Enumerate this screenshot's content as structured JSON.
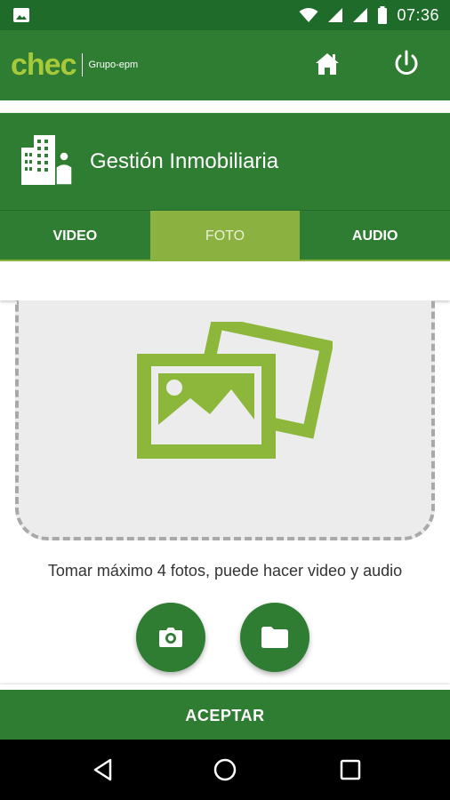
{
  "status_bar": {
    "time": "07:36",
    "icons": [
      "image-notification-icon",
      "wifi-icon",
      "signal-icon",
      "signal-icon",
      "battery-icon"
    ]
  },
  "app_bar": {
    "logo_text": "chec",
    "logo_group": "Grupo-epm",
    "home_icon": "home-icon",
    "power_icon": "power-icon"
  },
  "header": {
    "title": "Gestión Inmobiliaria",
    "icon": "building-person-icon"
  },
  "tabs": [
    {
      "label": "VIDEO",
      "active": false
    },
    {
      "label": "FOTO",
      "active": true
    },
    {
      "label": "AUDIO",
      "active": false
    }
  ],
  "media": {
    "placeholder_icon": "photos-icon",
    "hint": "Tomar máximo 4 fotos, puede hacer video y audio"
  },
  "actions": {
    "camera_icon": "camera-icon",
    "folder_icon": "folder-icon",
    "accept_label": "ACEPTAR"
  },
  "nav": {
    "back_icon": "back-icon",
    "home_icon": "home-circle-icon",
    "recent_icon": "recent-apps-icon"
  },
  "colors": {
    "primary": "#2e7d32",
    "status_bar": "#1f6b2a",
    "accent": "#8bb140",
    "illustration": "#8db73a"
  }
}
